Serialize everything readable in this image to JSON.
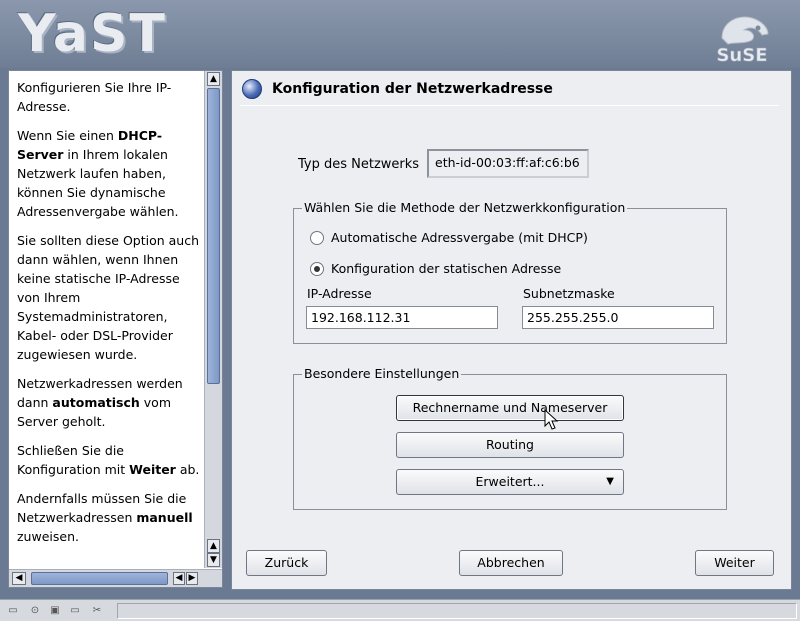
{
  "header": {
    "logo_text": "YaST",
    "brand_logo": "suse-logo",
    "brand_text": "SuSE"
  },
  "help": {
    "paragraphs": [
      [
        {
          "t": "Konfigurieren Sie Ihre IP-Adresse."
        }
      ],
      [
        {
          "t": "Wenn Sie einen "
        },
        {
          "t": "DHCP-Server",
          "b": true
        },
        {
          "t": " in Ihrem lokalen Netzwerk laufen haben, können Sie dynamische Adressenvergabe wählen."
        }
      ],
      [
        {
          "t": "Sie sollten diese Option auch dann wählen, wenn Ihnen keine statische IP-Adresse von Ihrem Systemadministratoren, Kabel- oder DSL-Provider zugewiesen wurde."
        }
      ],
      [
        {
          "t": "Netzwerkadressen werden dann "
        },
        {
          "t": "automatisch",
          "b": true
        },
        {
          "t": " vom Server geholt."
        }
      ],
      [
        {
          "t": "Schließen Sie die Konfiguration mit "
        },
        {
          "t": "Weiter",
          "b": true
        },
        {
          "t": " ab."
        }
      ],
      [
        {
          "t": "Andernfalls müssen Sie die Netzwerkadressen "
        },
        {
          "t": "manuell",
          "b": true
        },
        {
          "t": " zuweisen."
        }
      ]
    ]
  },
  "main": {
    "title": "Konfiguration der Netzwerkadresse",
    "network_type_label": "Typ des Netzwerks",
    "network_type_value": "eth-id-00:03:ff:af:c6:b6",
    "method_group": {
      "title": "Wählen Sie die Methode der Netzwerkkonfiguration",
      "options": [
        {
          "label": "Automatische Adressvergabe (mit DHCP)",
          "selected": false
        },
        {
          "label": "Konfiguration der statischen Adresse",
          "selected": true
        }
      ],
      "ip_label": "IP-Adresse",
      "ip_value": "192.168.112.31",
      "subnet_label": "Subnetzmaske",
      "subnet_value": "255.255.255.0"
    },
    "special_group": {
      "title": "Besondere Einstellungen",
      "hostname_button": "Rechnername und Nameserver",
      "routing_button": "Routing",
      "advanced_button": "Erweitert..."
    },
    "back_button": "Zurück",
    "cancel_button": "Abbrechen",
    "next_button": "Weiter"
  }
}
